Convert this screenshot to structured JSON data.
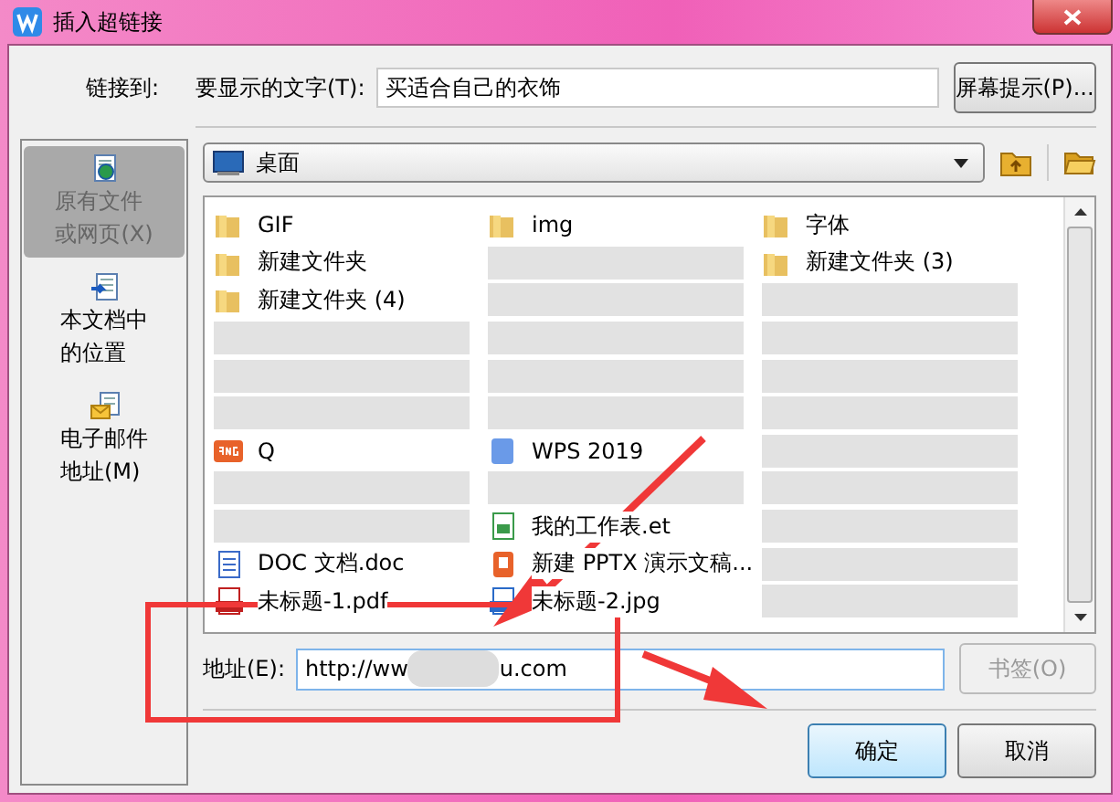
{
  "window": {
    "title": "插入超链接"
  },
  "link_to": {
    "label": "链接到:",
    "items": [
      {
        "kind": "file",
        "lines": [
          "原有文件",
          "或网页(X)"
        ],
        "selected": true
      },
      {
        "kind": "place",
        "lines": [
          "本文档中",
          "的位置"
        ],
        "selected": false
      },
      {
        "kind": "mail",
        "lines": [
          "电子邮件",
          "地址(M)"
        ],
        "selected": false
      }
    ]
  },
  "display_text": {
    "label": "要显示的文字(T):",
    "value": "买适合自己的衣饰"
  },
  "screen_tip_button": "屏幕提示(P)...",
  "location": {
    "value": "桌面"
  },
  "files": [
    {
      "kind": "folder",
      "name": "GIF"
    },
    {
      "kind": "folder",
      "name": "img"
    },
    {
      "kind": "folder",
      "name": "字体"
    },
    {
      "kind": "folder",
      "name": "新建文件夹"
    },
    {
      "kind": "blurred"
    },
    {
      "kind": "folder",
      "name": "新建文件夹 (3)"
    },
    {
      "kind": "folder",
      "name": "新建文件夹 (4)"
    },
    {
      "kind": "blurred"
    },
    {
      "kind": "blurred"
    },
    {
      "kind": "blurred"
    },
    {
      "kind": "blurred"
    },
    {
      "kind": "blurred"
    },
    {
      "kind": "blurred"
    },
    {
      "kind": "blurred"
    },
    {
      "kind": "blurred"
    },
    {
      "kind": "blurred"
    },
    {
      "kind": "blurred"
    },
    {
      "kind": "blurred"
    },
    {
      "kind": "png",
      "name": "Q"
    },
    {
      "kind": "app",
      "name": "WPS 2019"
    },
    {
      "kind": "blurred"
    },
    {
      "kind": "blurred"
    },
    {
      "kind": "blurred"
    },
    {
      "kind": "blurred"
    },
    {
      "kind": "blurred"
    },
    {
      "kind": "et",
      "name": "我的工作表.et"
    },
    {
      "kind": "blurred"
    },
    {
      "kind": "doc",
      "name": "DOC 文档.doc"
    },
    {
      "kind": "ppt",
      "name": "新建 PPTX 演示文稿..."
    },
    {
      "kind": "blurred"
    },
    {
      "kind": "pdf",
      "name": "未标题-1.pdf"
    },
    {
      "kind": "jpg",
      "name": "未标题-2.jpg"
    },
    {
      "kind": "blurred"
    }
  ],
  "address": {
    "label": "地址(E):",
    "value_start": "http://ww",
    "value_end": "u.com"
  },
  "bookmark_button": {
    "label": "书签(O)",
    "disabled": true
  },
  "buttons": [
    {
      "label": "确定",
      "default": true
    },
    {
      "label": "取消",
      "default": false
    }
  ]
}
